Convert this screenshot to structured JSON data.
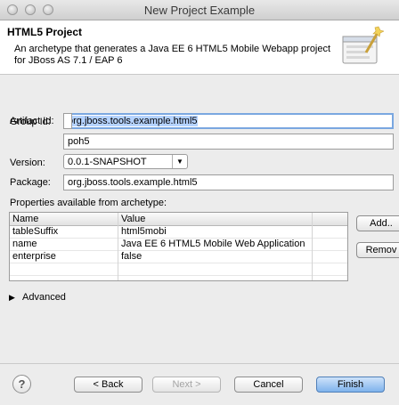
{
  "window": {
    "title": "New Project Example"
  },
  "header": {
    "title": "HTML5 Project",
    "description": "An archetype that generates a Java EE 6 HTML5 Mobile Webapp project for JBoss AS 7.1 / EAP 6",
    "icon": "wizard-banner-icon"
  },
  "form": {
    "group_id_label": "Group Id:",
    "group_id_value": "org.jboss.tools.example.html5",
    "artifact_id_label": "Artifact Id:",
    "artifact_id_value": "poh5",
    "version_label": "Version:",
    "version_value": "0.0.1-SNAPSHOT",
    "package_label": "Package:",
    "package_value": "org.jboss.tools.example.html5"
  },
  "properties": {
    "label": "Properties available from archetype:",
    "columns": [
      "Name",
      "Value"
    ],
    "rows": [
      {
        "name": "tableSuffix",
        "value": "html5mobi"
      },
      {
        "name": "name",
        "value": "Java EE 6 HTML5 Mobile Web Application"
      },
      {
        "name": "enterprise",
        "value": "false"
      }
    ],
    "add_label": "Add..",
    "remove_label": "Remov"
  },
  "advanced": {
    "label": "Advanced"
  },
  "footer": {
    "help_label": "?",
    "back_label": "< Back",
    "next_label": "Next >",
    "cancel_label": "Cancel",
    "finish_label": "Finish"
  }
}
